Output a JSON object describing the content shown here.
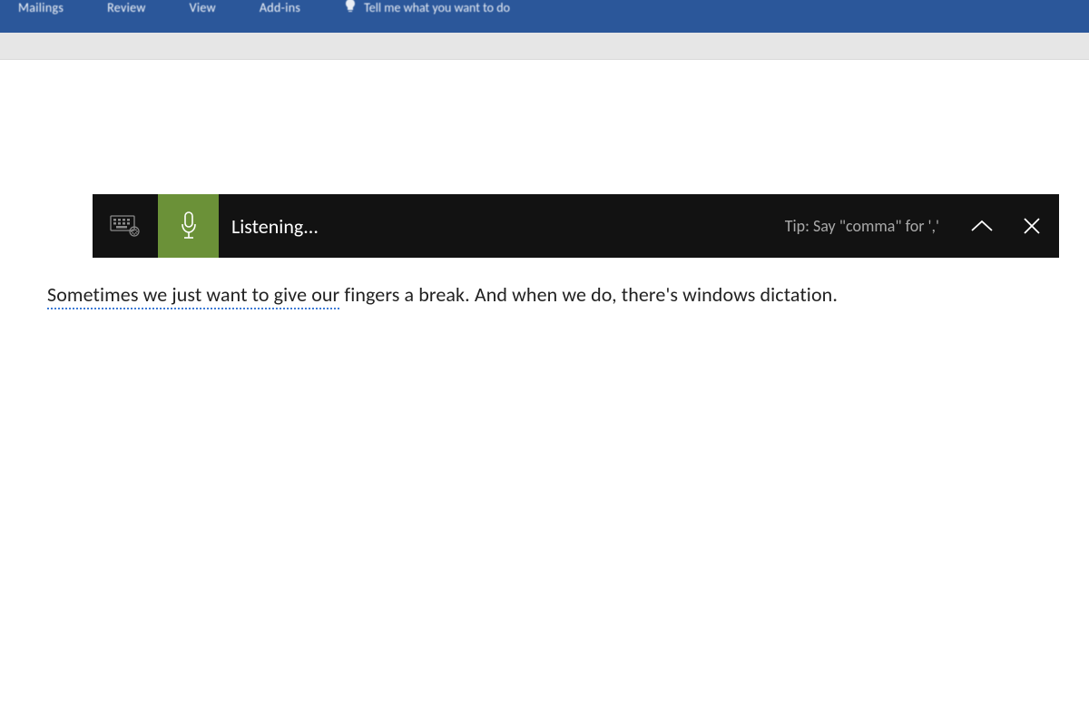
{
  "ribbon": {
    "tabs": {
      "mailings": "Mailings",
      "review": "Review",
      "view": "View",
      "addins": "Add-ins"
    },
    "hint": "Tell me what you want to do"
  },
  "dictation": {
    "status": "Listening...",
    "tip": "Tip: Say \"comma\" for ','"
  },
  "document": {
    "text_underlined": "Sometimes we just want to give our",
    "text_rest": " fingers a break. And when we do, there's windows dictation."
  }
}
